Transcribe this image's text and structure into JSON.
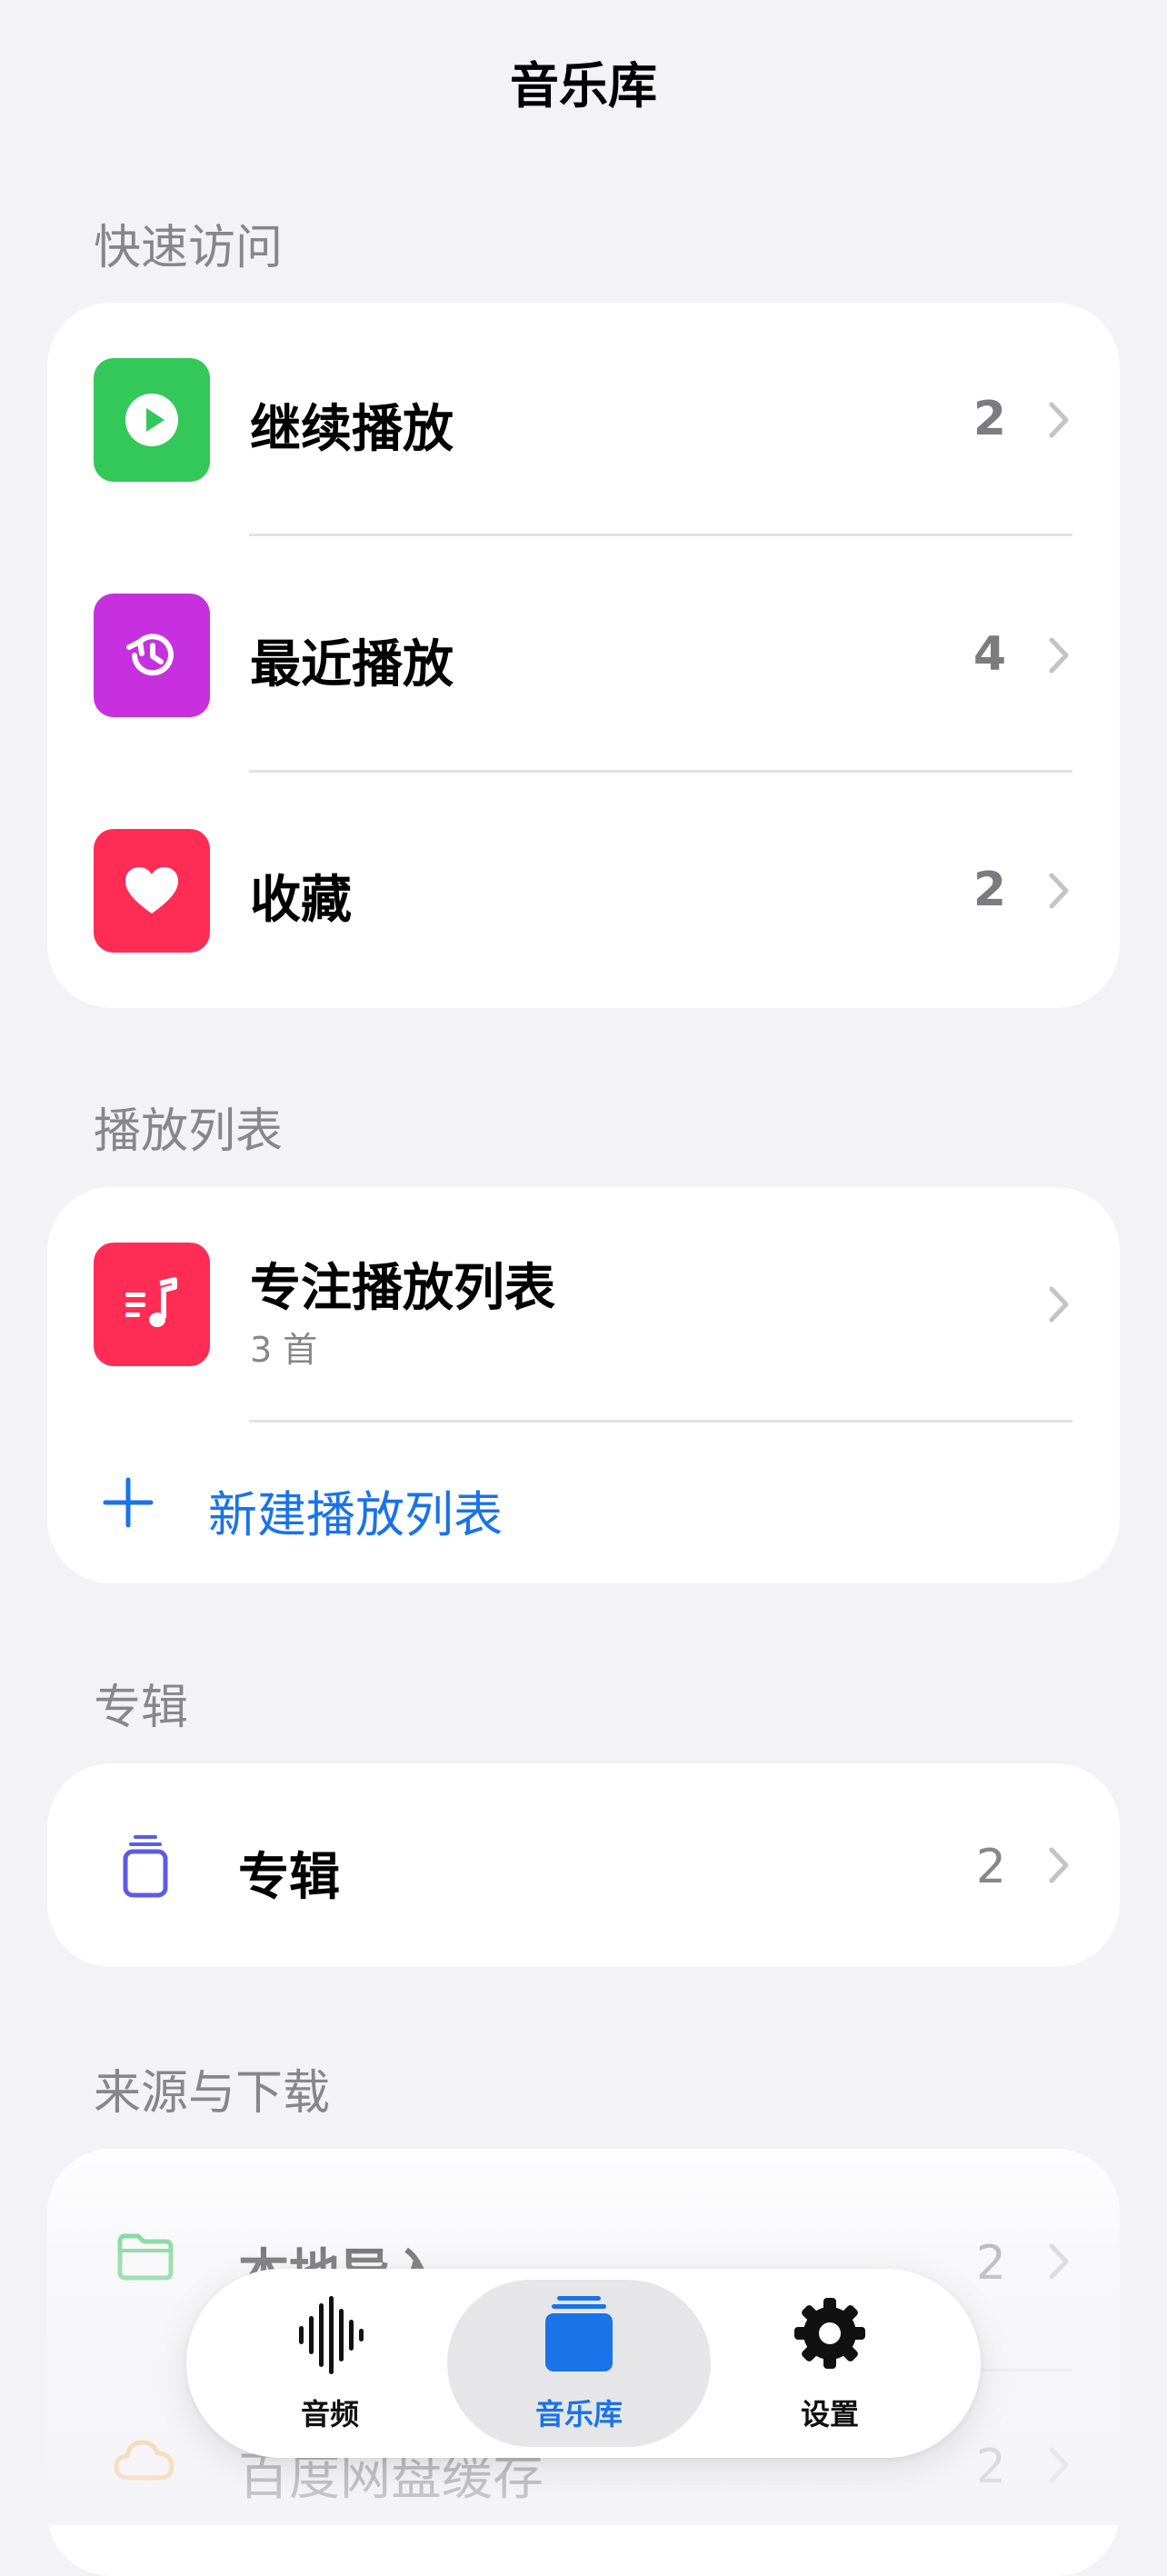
{
  "nav": {
    "title": "音乐库"
  },
  "quick_access": {
    "header": "快速访问",
    "items": [
      {
        "label": "继续播放",
        "count": "2",
        "icon": "play-circle-icon",
        "color": "#34c759"
      },
      {
        "label": "最近播放",
        "count": "4",
        "icon": "history-icon",
        "color": "#c730de"
      },
      {
        "label": "收藏",
        "count": "2",
        "icon": "heart-icon",
        "color": "#ff2d55"
      }
    ]
  },
  "playlists": {
    "header": "播放列表",
    "items": [
      {
        "title": "专注播放列表",
        "subtitle": "3 首",
        "icon": "music-list-icon",
        "color": "#ff2d55"
      }
    ],
    "new_label": "新建播放列表"
  },
  "albums": {
    "header": "专辑",
    "items": [
      {
        "label": "专辑",
        "count": "2",
        "icon": "album-stack-icon"
      }
    ]
  },
  "sources": {
    "header": "来源与下载",
    "items": [
      {
        "label": "本地导入",
        "count": "2",
        "icon": "folder-icon"
      },
      {
        "label": "百度网盘缓存",
        "count": "2",
        "icon": "cloud-icon"
      }
    ]
  },
  "tabbar": {
    "tabs": [
      {
        "label": "音频",
        "icon": "waveform-icon"
      },
      {
        "label": "音乐库",
        "icon": "library-icon",
        "active": true
      },
      {
        "label": "设置",
        "icon": "gear-icon"
      }
    ]
  },
  "colors": {
    "accent": "#1a73e8",
    "background": "#f2f2f7",
    "secondary_text": "#86868b"
  }
}
